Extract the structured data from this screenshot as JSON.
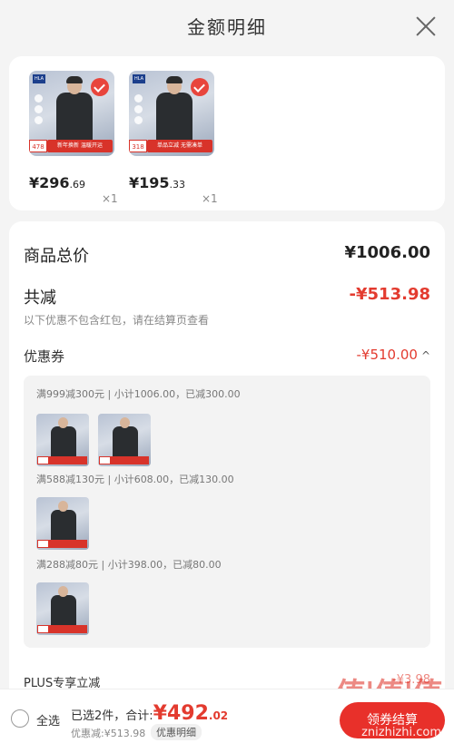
{
  "header": {
    "title": "金额明细"
  },
  "products": [
    {
      "price_int": "¥296",
      "price_dec": ".69",
      "qty": "×1",
      "tag": "478",
      "banner": "新年换新 温暖开运"
    },
    {
      "price_int": "¥195",
      "price_dec": ".33",
      "qty": "×1",
      "tag": "318",
      "banner": "单品立减 无需凑单"
    }
  ],
  "summary": {
    "goods_total_label": "商品总价",
    "goods_total": "¥1006.00",
    "reduce_label": "共减",
    "reduce_amount": "-¥513.98",
    "note": "以下优惠不包含红包，请在结算页查看",
    "coupon_label": "优惠券",
    "coupon_amount": "-¥510.00",
    "coupon_chevron": "^"
  },
  "coupon_groups": [
    {
      "rule": "满999减300元 | 小计1006.00，已减300.00"
    },
    {
      "rule": "满588减130元 | 小计608.00，已减130.00"
    },
    {
      "rule": "满288减80元 | 小计398.00，已减80.00"
    }
  ],
  "plus": {
    "label": "PLUS专享立减",
    "amount": "-¥3.98"
  },
  "bottom": {
    "select_all": "全选",
    "selected_prefix": "已选2件，合计:",
    "total_int": "¥492",
    "total_dec": ".02",
    "discount": "优惠减:¥513.98",
    "detail_button": "优惠明细",
    "pay_button": "领券结算"
  },
  "watermark": {
    "logo": "值|值|值",
    "site": "znizhizhi.com"
  },
  "colors": {
    "accent_red": "#e33b2f",
    "background": "#f4f4f4"
  }
}
